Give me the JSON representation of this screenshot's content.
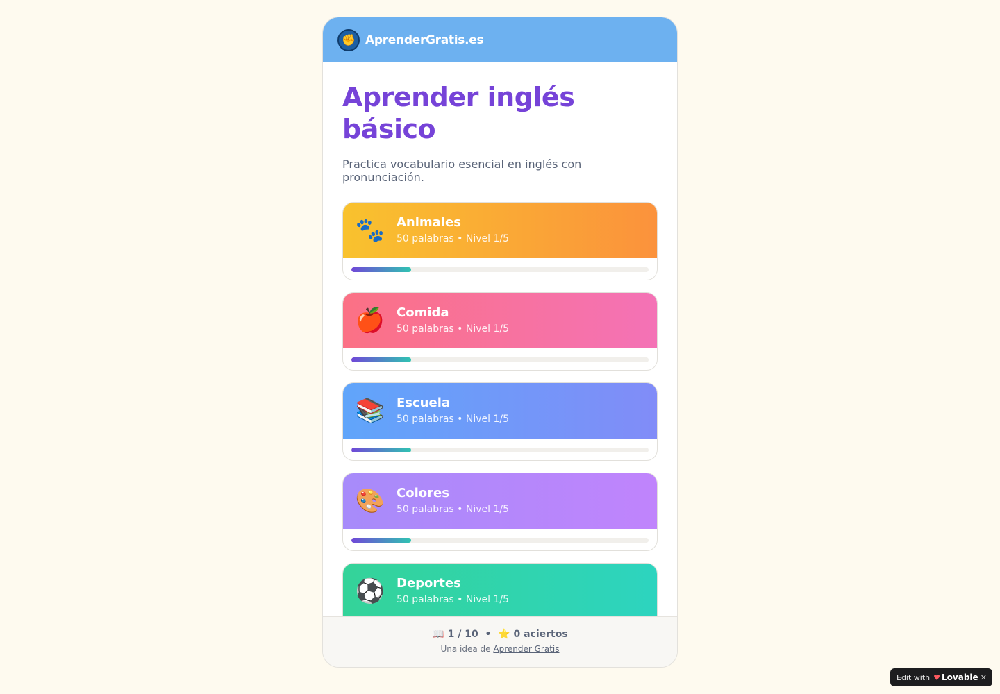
{
  "header": {
    "logo_icon": "raised-fist-icon",
    "brand": "AprenderGratis.es"
  },
  "main": {
    "title": "Aprender inglés básico",
    "subtitle": "Practica vocabulario esencial en inglés con pronunciación."
  },
  "categories": [
    {
      "emoji": "🐾",
      "icon": "paw-icon",
      "name": "Animales",
      "meta": "50 palabras • Nivel 1/5",
      "progress": 0.2,
      "gradient_from": "#f9c22e",
      "gradient_to": "#fb923c"
    },
    {
      "emoji": "🍎",
      "icon": "apple-icon",
      "name": "Comida",
      "meta": "50 palabras • Nivel 1/5",
      "progress": 0.2,
      "gradient_from": "#fb7185",
      "gradient_to": "#f472b6"
    },
    {
      "emoji": "📚",
      "icon": "books-icon",
      "name": "Escuela",
      "meta": "50 palabras • Nivel 1/5",
      "progress": 0.2,
      "gradient_from": "#60a5fa",
      "gradient_to": "#818cf8"
    },
    {
      "emoji": "🎨",
      "icon": "palette-icon",
      "name": "Colores",
      "meta": "50 palabras • Nivel 1/5",
      "progress": 0.2,
      "gradient_from": "#a78bfa",
      "gradient_to": "#c084fc"
    },
    {
      "emoji": "⚽",
      "icon": "soccer-ball-icon",
      "name": "Deportes",
      "meta": "50 palabras • Nivel 1/5",
      "progress": 0.2,
      "gradient_from": "#34d399",
      "gradient_to": "#2dd4bf"
    }
  ],
  "footer": {
    "book_emoji": "📖",
    "page_progress": "1 / 10",
    "separator": "•",
    "star_emoji": "⭐",
    "score": "0 aciertos",
    "credit_prefix": "Una idea de",
    "credit_link": "Aprender Gratis"
  },
  "badge": {
    "edit_with": "Edit with",
    "heart": "♥",
    "name": "Lovable",
    "close": "✕"
  },
  "colors": {
    "header_bg": "#6db1f0",
    "title": "#7643d8",
    "page_bg": "#fefaef"
  }
}
